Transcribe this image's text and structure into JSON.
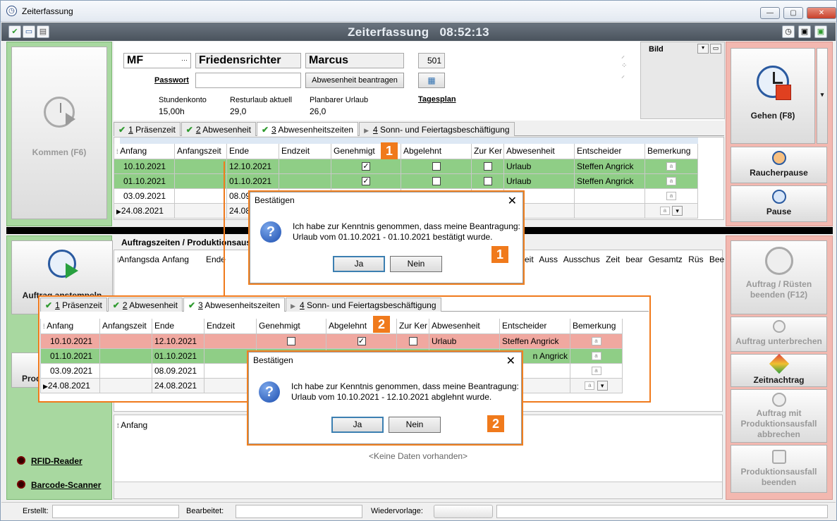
{
  "window": {
    "title": "Zeiterfassung",
    "minimize": "—",
    "maximize": "▢",
    "close": "✕"
  },
  "header": {
    "title": "Zeiterfassung   08:52:13"
  },
  "toolbar": {
    "icons": [
      "check-icon",
      "window-icon",
      "document-icon"
    ],
    "right_icons": [
      "clock-icon",
      "cube-icon",
      "cube-arrow-icon"
    ]
  },
  "left": {
    "kommen": "Kommen (F6)",
    "auftrag_anstempeln": "Auftrag anstempeln",
    "prod_partial": "Prod",
    "rfid": "RFID-Reader",
    "barcode": "Barcode-Scanner"
  },
  "right": {
    "gehen": "Gehen (F8)",
    "raucher": "Raucherpause",
    "pause": "Pause",
    "auftrag_ruesten": "Auftrag / Rüsten beenden (F12)",
    "auftrag_unterbrechen": "Auftrag unterbrechen",
    "zeitnachtrag": "Zeitnachtrag",
    "auftrag_produktionsausfall": "Auftrag mit Produktionsausfall abbrechen",
    "produktionsausfall_beenden": "Produktionsausfall beenden"
  },
  "employee": {
    "code": "MF",
    "ellipsis": "···",
    "lastname": "Friedensrichter",
    "firstname": "Marcus",
    "number": "501",
    "password_label": "Passwort",
    "password_value": "",
    "absence_button": "Abwesenheit beantragen",
    "tagesplan": "Tagesplan",
    "bild": "Bild",
    "stundenkonto_label": "Stundenkonto",
    "stundenkonto": "15,00h",
    "resturlaub_label": "Resturlaub aktuell",
    "resturlaub": "29,0",
    "planbar_label": "Planbarer Urlaub",
    "planbar": "26,0"
  },
  "tabs": [
    {
      "num": "1",
      "label": "Präsenzeit"
    },
    {
      "num": "2",
      "label": "Abwesenheit"
    },
    {
      "num": "3",
      "label": "Abwesenheitszeiten"
    },
    {
      "num": "4",
      "label": "Sonn- und Feiertagsbeschäftigung"
    }
  ],
  "columns": [
    "Anfang",
    "Anfangszeit",
    "Ende",
    "Endzeit",
    "Genehmigt",
    "Abgelehnt",
    "Zur Ker",
    "Abwesenheit",
    "Entscheider",
    "Bemerkung"
  ],
  "grid1": [
    {
      "anfang": "10.10.2021",
      "ende": "12.10.2021",
      "gen": "✓",
      "abg": "",
      "zur": "",
      "abw": "Urlaub",
      "ent": "Steffen Angrick"
    },
    {
      "anfang": "01.10.2021",
      "ende": "01.10.2021",
      "gen": "✓",
      "abg": "",
      "zur": "",
      "abw": "Urlaub",
      "ent": "Steffen Angrick"
    },
    {
      "anfang": "03.09.2021",
      "ende": "08.09",
      "gen": "",
      "abg": "",
      "zur": "",
      "abw": "ub",
      "ent": ""
    },
    {
      "anfang": "24.08.2021",
      "ende": "24.08",
      "gen": "",
      "abg": "",
      "zur": "",
      "abw": "ub",
      "ent": ""
    }
  ],
  "grid2": [
    {
      "anfang": "10.10.2021",
      "ende": "12.10.2021",
      "gen": "",
      "abg": "✓",
      "zur": "",
      "abw": "Urlaub",
      "ent": "Steffen Angrick"
    },
    {
      "anfang": "01.10.2021",
      "ende": "01.10.2021",
      "gen": "",
      "abg": "",
      "zur": "",
      "abw": "",
      "ent": "n Angrick"
    },
    {
      "anfang": "03.09.2021",
      "ende": "08.09.2021",
      "gen": "",
      "abg": "",
      "zur": "",
      "abw": "",
      "ent": ""
    },
    {
      "anfang": "24.08.2021",
      "ende": "24.08.2021",
      "gen": "",
      "abg": "",
      "zur": "",
      "abw": "",
      "ent": ""
    }
  ],
  "orders": {
    "title": "Auftragszeiten / Produktionsaus",
    "columns": [
      "Anfangsda",
      "Anfang",
      "Ende"
    ],
    "columns_right": [
      "zeit",
      "Auss",
      "Ausschus",
      "Zeit bear",
      "Gesamtz",
      "Rüs",
      "Bee"
    ],
    "bottom_column": "Anfang",
    "no_data": "<Keine Daten vorhanden>"
  },
  "dialog1": {
    "title": "Bestätigen",
    "line1": "Ich habe zur Kenntnis genommen, dass meine Beantragung:",
    "line2": "Urlaub vom 01.10.2021 - 01.10.2021 bestätigt wurde.",
    "yes": "Ja",
    "no": "Nein",
    "badge": "1"
  },
  "dialog2": {
    "title": "Bestätigen",
    "line1": "Ich habe zur Kenntnis genommen, dass meine Beantragung:",
    "line2": "Urlaub vom 10.10.2021 - 12.10.2021 abglehnt wurde.",
    "yes": "Ja",
    "no": "Nein",
    "badge": "2"
  },
  "statusbar": {
    "erstellt": "Erstellt:",
    "bearbeitet": "Bearbeitet:",
    "wiedervorlage": "Wiedervorlage:"
  },
  "colors": {
    "green": "#8fce86",
    "red": "#f0a8a0",
    "accent": "#f07a1c"
  }
}
